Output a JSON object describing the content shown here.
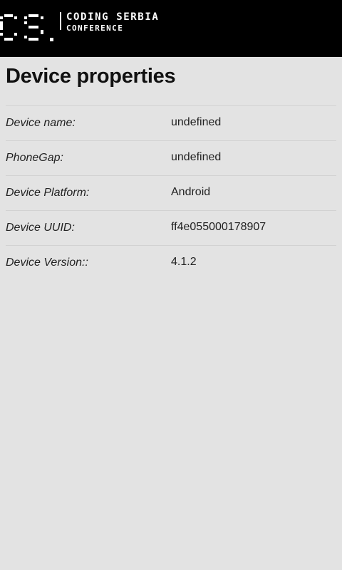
{
  "header": {
    "logo_line1": "CODING SERBIA",
    "logo_line2": "CONFERENCE",
    "logo_mark": "CS."
  },
  "page": {
    "title": "Device properties"
  },
  "properties": [
    {
      "label": "Device name:",
      "value": "undefined"
    },
    {
      "label": "PhoneGap:",
      "value": "undefined"
    },
    {
      "label": "Device Platform:",
      "value": "Android"
    },
    {
      "label": "Device UUID:",
      "value": "ff4e055000178907"
    },
    {
      "label": "Device Version::",
      "value": "4.1.2"
    }
  ]
}
